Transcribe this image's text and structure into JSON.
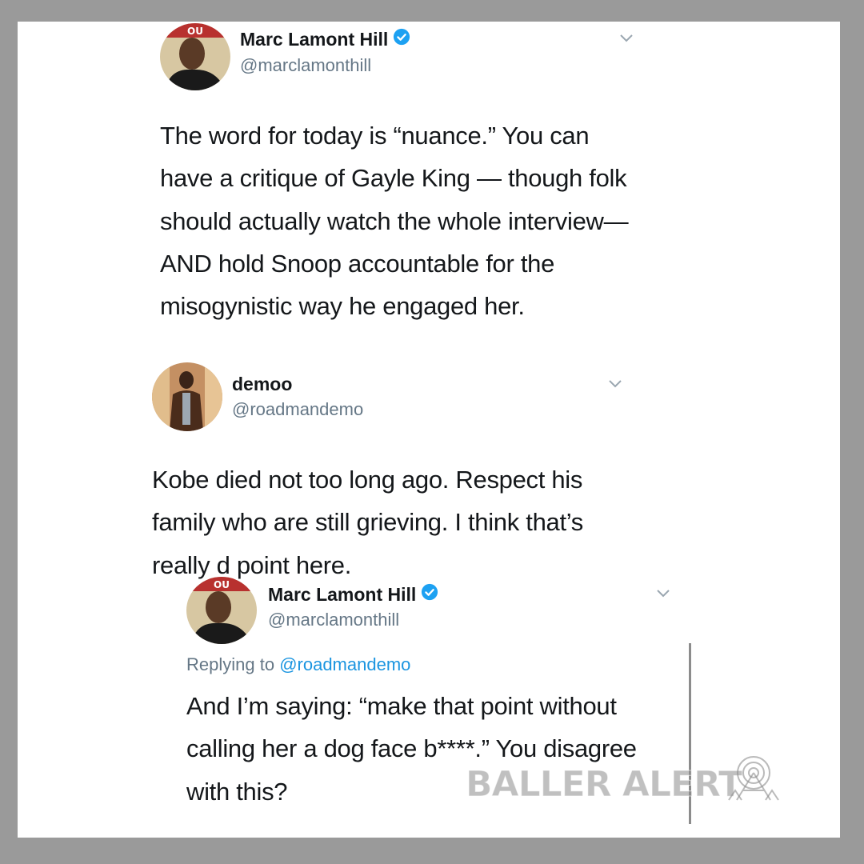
{
  "tweets": [
    {
      "name": "Marc Lamont Hill",
      "handle": "@marclamonthill",
      "verified": true,
      "text": "The word for today is “nuance.” You can have a critique of Gayle King — though folk should actually watch the whole interview— AND hold Snoop accountable for the misogynistic way he engaged her."
    },
    {
      "name": "demoo",
      "handle": "@roadmandemo",
      "verified": false,
      "text": "Kobe died not too long ago. Respect his family who are still grieving. I think that’s really d point here."
    },
    {
      "name": "Marc Lamont Hill",
      "handle": "@marclamonthill",
      "verified": true,
      "replying_prefix": "Replying to ",
      "replying_handle": "@roadmandemo",
      "text": "And I’m saying: “make that point without calling her a dog face b****.” You disagree with this?"
    }
  ],
  "watermark": "BALLER ALERT",
  "colors": {
    "background": "#9a9a9a",
    "card": "#ffffff",
    "verified_blue": "#1da1f2",
    "link_blue": "#1b95e0",
    "handle_gray": "#657786",
    "text": "#14171a"
  },
  "icons": [
    "avatar",
    "verified-badge-icon",
    "chevron-down-icon",
    "baller-alert-tower-icon"
  ]
}
